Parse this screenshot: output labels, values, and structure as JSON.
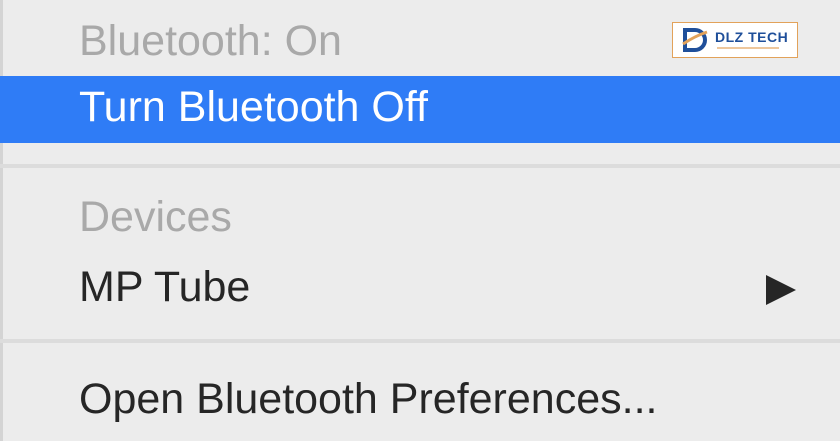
{
  "menu": {
    "status_header": "Bluetooth: On",
    "turn_off_label": "Turn Bluetooth Off",
    "devices_header": "Devices",
    "device_name": "MP Tube",
    "device_submenu_icon": "triangle-right-icon",
    "open_preferences_label": "Open Bluetooth Preferences..."
  },
  "watermark": {
    "brand": "DLZ TECH"
  },
  "colors": {
    "highlight": "#2f7cf6",
    "menu_background": "#ececec",
    "disabled_text": "#a9a9a9",
    "text": "#262626",
    "logo_border": "#e2a25a",
    "logo_text": "#1f4f9a"
  }
}
